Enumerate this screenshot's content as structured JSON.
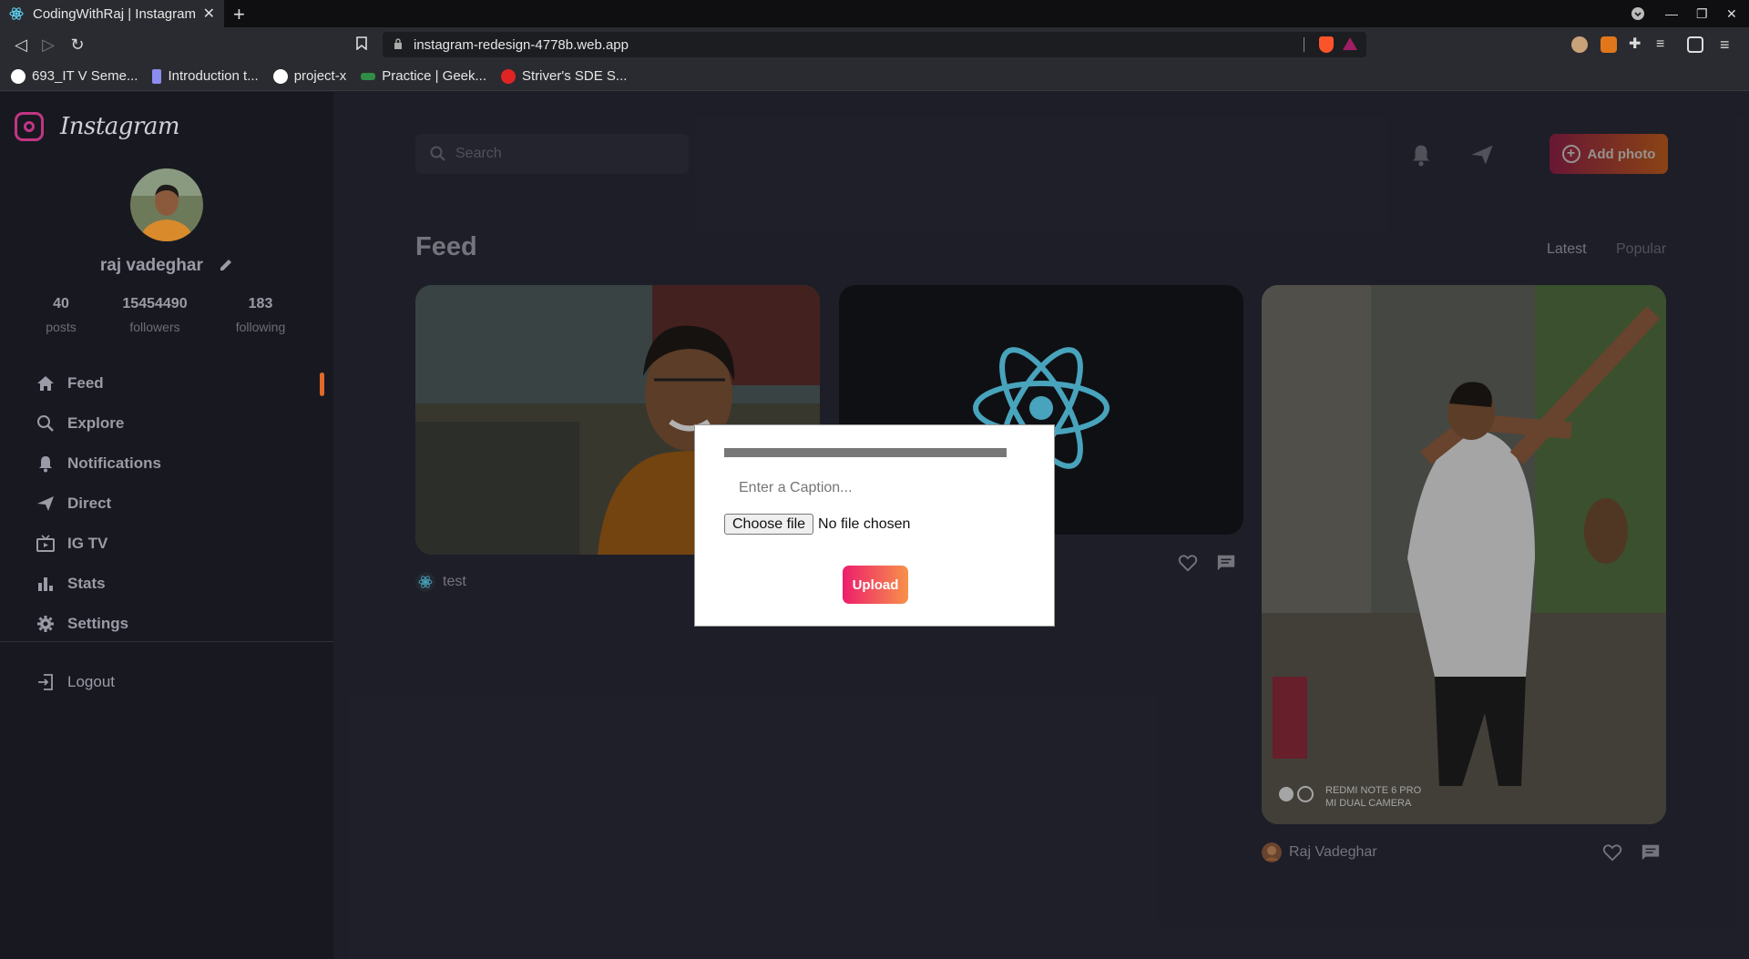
{
  "browser": {
    "tab_title": "CodingWithRaj | Instagram",
    "url": "instagram-redesign-4778b.web.app",
    "brave_badge": "1",
    "bookmarks": [
      {
        "label": "693_IT V Seme...",
        "color": "#ffffff"
      },
      {
        "label": "Introduction t...",
        "color": "#8c8cf0"
      },
      {
        "label": "project-x",
        "color": "#ffffff"
      },
      {
        "label": "Practice | Geek...",
        "color": "#2f8d46"
      },
      {
        "label": "Striver's SDE S...",
        "color": "#e02424"
      }
    ]
  },
  "sidebar": {
    "brand": "Instagram",
    "username": "raj vadeghar",
    "stats": [
      {
        "value": "40",
        "label": "posts"
      },
      {
        "value": "15454490",
        "label": "followers"
      },
      {
        "value": "183",
        "label": "following"
      }
    ],
    "nav": [
      {
        "label": "Feed",
        "icon": "home-icon"
      },
      {
        "label": "Explore",
        "icon": "search-icon"
      },
      {
        "label": "Notifications",
        "icon": "bell-icon"
      },
      {
        "label": "Direct",
        "icon": "send-icon"
      },
      {
        "label": "IG TV",
        "icon": "tv-icon"
      },
      {
        "label": "Stats",
        "icon": "bar-chart-icon"
      },
      {
        "label": "Settings",
        "icon": "gear-icon"
      }
    ],
    "logout": "Logout"
  },
  "header": {
    "search_placeholder": "Search",
    "add_photo": "Add photo"
  },
  "feed": {
    "title": "Feed",
    "sort_latest": "Latest",
    "sort_popular": "Popular",
    "posts": [
      {
        "author": "test"
      },
      {
        "author": ""
      },
      {
        "author": "Raj Vadeghar",
        "camera_line1": "REDMI NOTE 6 PRO",
        "camera_line2": "MI DUAL CAMERA"
      }
    ]
  },
  "modal": {
    "caption_placeholder": "Enter a Caption...",
    "choose_file": "Choose file",
    "no_file": "No file chosen",
    "upload": "Upload"
  },
  "colors": {
    "accent_orange": "#e06a2a",
    "upload_gradient_start": "#ed1e6c",
    "upload_gradient_end": "#f7924a",
    "react_blue": "#61dafb"
  }
}
